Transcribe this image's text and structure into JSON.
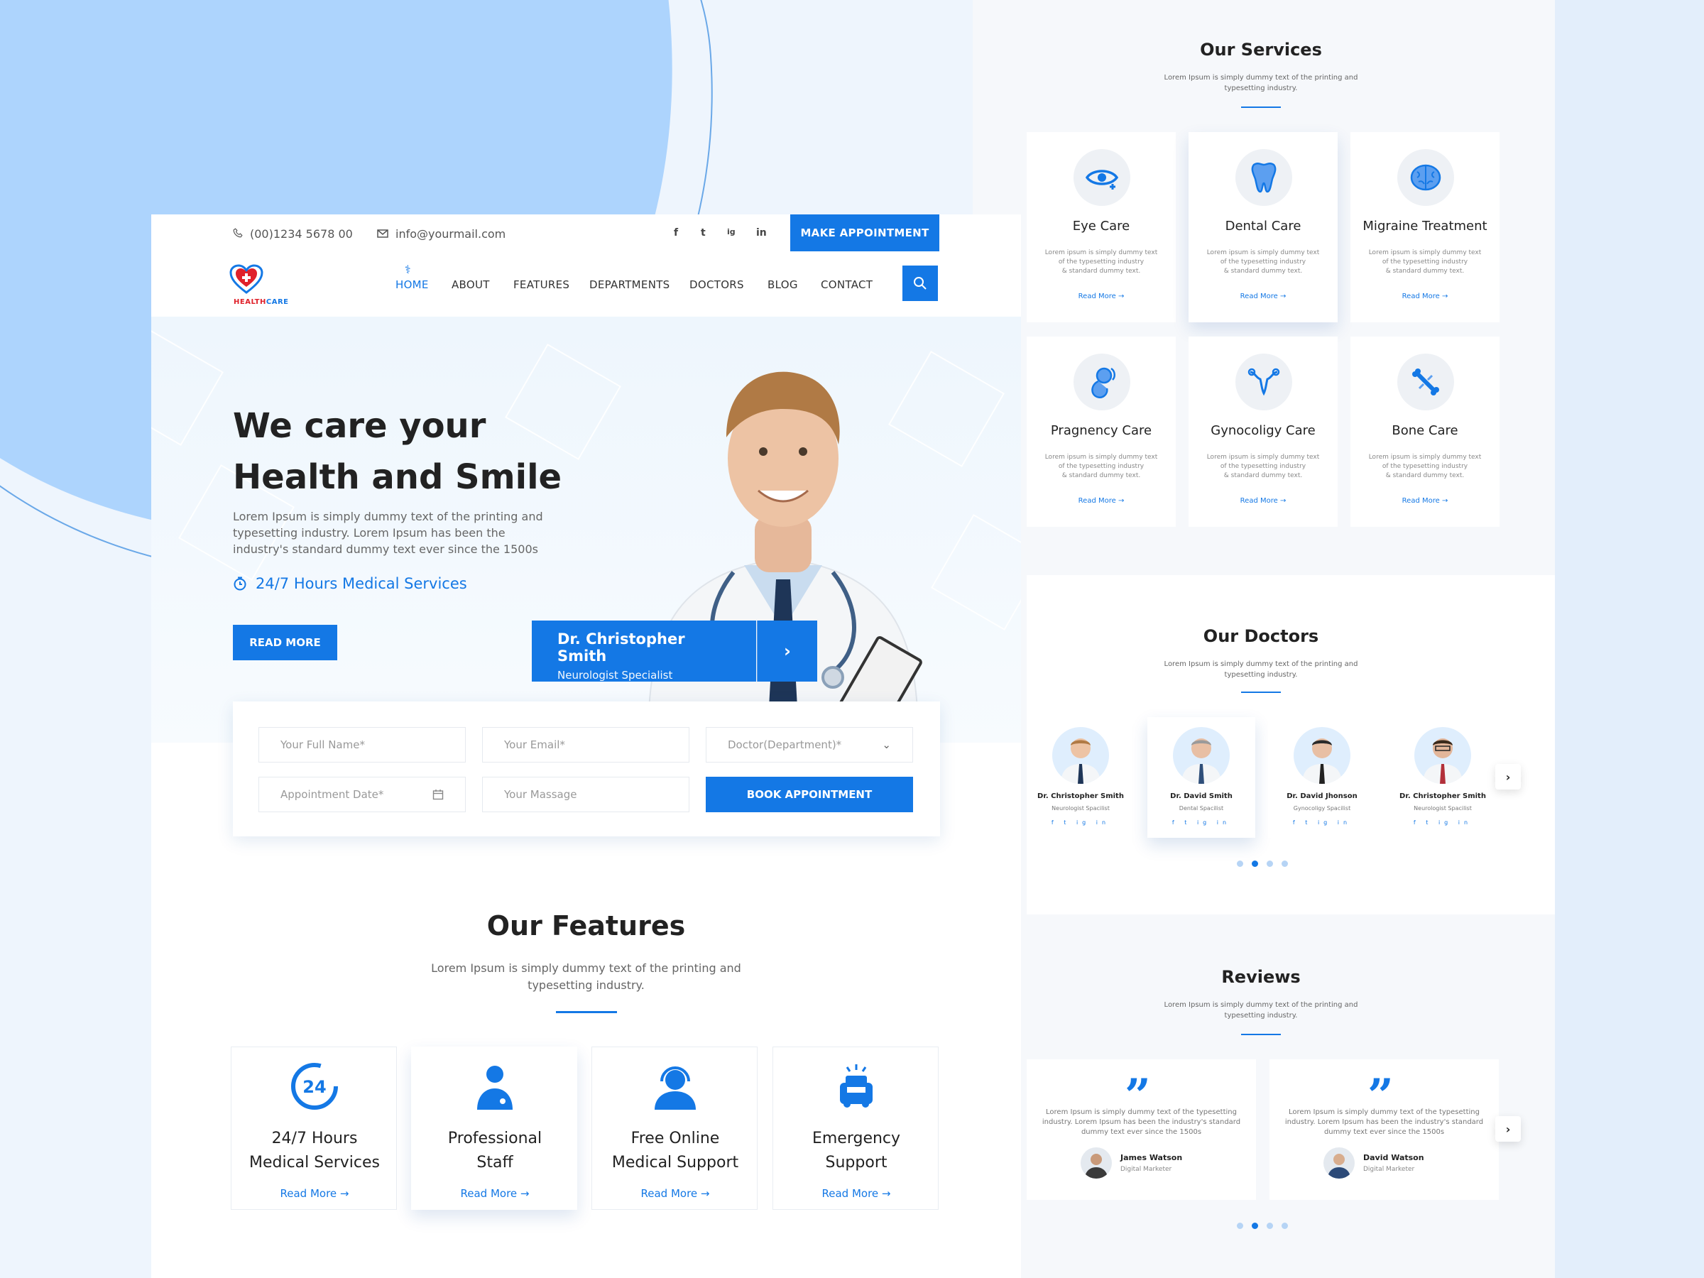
{
  "topbar": {
    "phone": "(00)1234 5678 00",
    "email": "info@yourmail.com",
    "social": [
      "f",
      "t",
      "ig",
      "in"
    ],
    "appointment_button": "MAKE APPOINTMENT"
  },
  "brand": {
    "name_a": "HEALTH",
    "name_b": "CARE"
  },
  "nav": {
    "items": [
      "HOME",
      "ABOUT",
      "FEATURES",
      "DEPARTMENTS",
      "DOCTORS",
      "BLOG",
      "CONTACT"
    ],
    "active": "HOME"
  },
  "hero": {
    "title_line1": "We care your",
    "title_line2": "Health and Smile",
    "text": "Lorem Ipsum is simply dummy text of the printing and typesetting industry. Lorem Ipsum has been the industry's standard dummy text ever since the 1500s",
    "service": "24/7 Hours Medical Services",
    "read_more": "READ MORE",
    "doctor_name": "Dr. Christopher Smith",
    "doctor_role": "Neurologist Specialist"
  },
  "form": {
    "name_placeholder": "Your Full Name*",
    "email_placeholder": "Your Email*",
    "department_placeholder": "Doctor(Department)*",
    "date_placeholder": "Appointment Date*",
    "message_placeholder": "Your Massage",
    "book_button": "BOOK APPOINTMENT"
  },
  "features": {
    "title": "Our Features",
    "subtitle_1": "Lorem Ipsum is simply dummy text of the printing and",
    "subtitle_2": "typesetting industry.",
    "items": [
      {
        "line1": "24/7 Hours",
        "line2": "Medical Services",
        "link": "Read More →",
        "icon": "24-hours-icon"
      },
      {
        "line1": "Professional",
        "line2": "Staff",
        "link": "Read More →",
        "icon": "doctor-icon"
      },
      {
        "line1": "Free Online",
        "line2": "Medical Support",
        "link": "Read More →",
        "icon": "headset-icon"
      },
      {
        "line1": "Emergency",
        "line2": "Support",
        "link": "Read More →",
        "icon": "ambulance-icon"
      }
    ]
  },
  "services": {
    "title": "Our Services",
    "subtitle_1": "Lorem Ipsum is simply dummy text of the printing and",
    "subtitle_2": "typesetting industry.",
    "items": [
      {
        "title": "Eye Care",
        "icon": "eye-icon"
      },
      {
        "title": "Dental Care",
        "icon": "tooth-icon"
      },
      {
        "title": "Migraine Treatment",
        "icon": "brain-icon"
      },
      {
        "title": "Pragnency Care",
        "icon": "fetus-icon"
      },
      {
        "title": "Gynocoligy Care",
        "icon": "uterus-icon"
      },
      {
        "title": "Bone Care",
        "icon": "bone-icon"
      }
    ],
    "desc_1": "Lorem ipsum is simply dummy text",
    "desc_2": "of the typesetting industry",
    "desc_3": "& standard dummy text.",
    "link": "Read More →"
  },
  "doctors": {
    "title": "Our Doctors",
    "subtitle_1": "Lorem Ipsum is simply dummy text of the printing and",
    "subtitle_2": "typesetting industry.",
    "items": [
      {
        "name": "Dr. Christopher Smith",
        "role": "Neurologist Spacilist"
      },
      {
        "name": "Dr. David Smith",
        "role": "Dental Spacilist"
      },
      {
        "name": "Dr. David  Jhonson",
        "role": "Gynocoligy Spacilist"
      },
      {
        "name": "Dr. Christopher Smith",
        "role": "Neurologist Spacilist"
      }
    ],
    "social": "f t ig in"
  },
  "reviews": {
    "title": "Reviews",
    "subtitle_1": "Lorem Ipsum is simply dummy text of the printing and",
    "subtitle_2": "typesetting industry.",
    "text": "Lorem Ipsum is simply dummy text of the typesetting industry. Lorem Ipsum has been the industry's standard dummy text ever since the 1500s",
    "items": [
      {
        "name": "James Watson",
        "role": "Digital Marketer"
      },
      {
        "name": "David Watson",
        "role": "Digital Marketer"
      }
    ]
  },
  "colors": {
    "accent": "#1478e5",
    "blob": "#add4fd",
    "background": "#eef5fd"
  }
}
